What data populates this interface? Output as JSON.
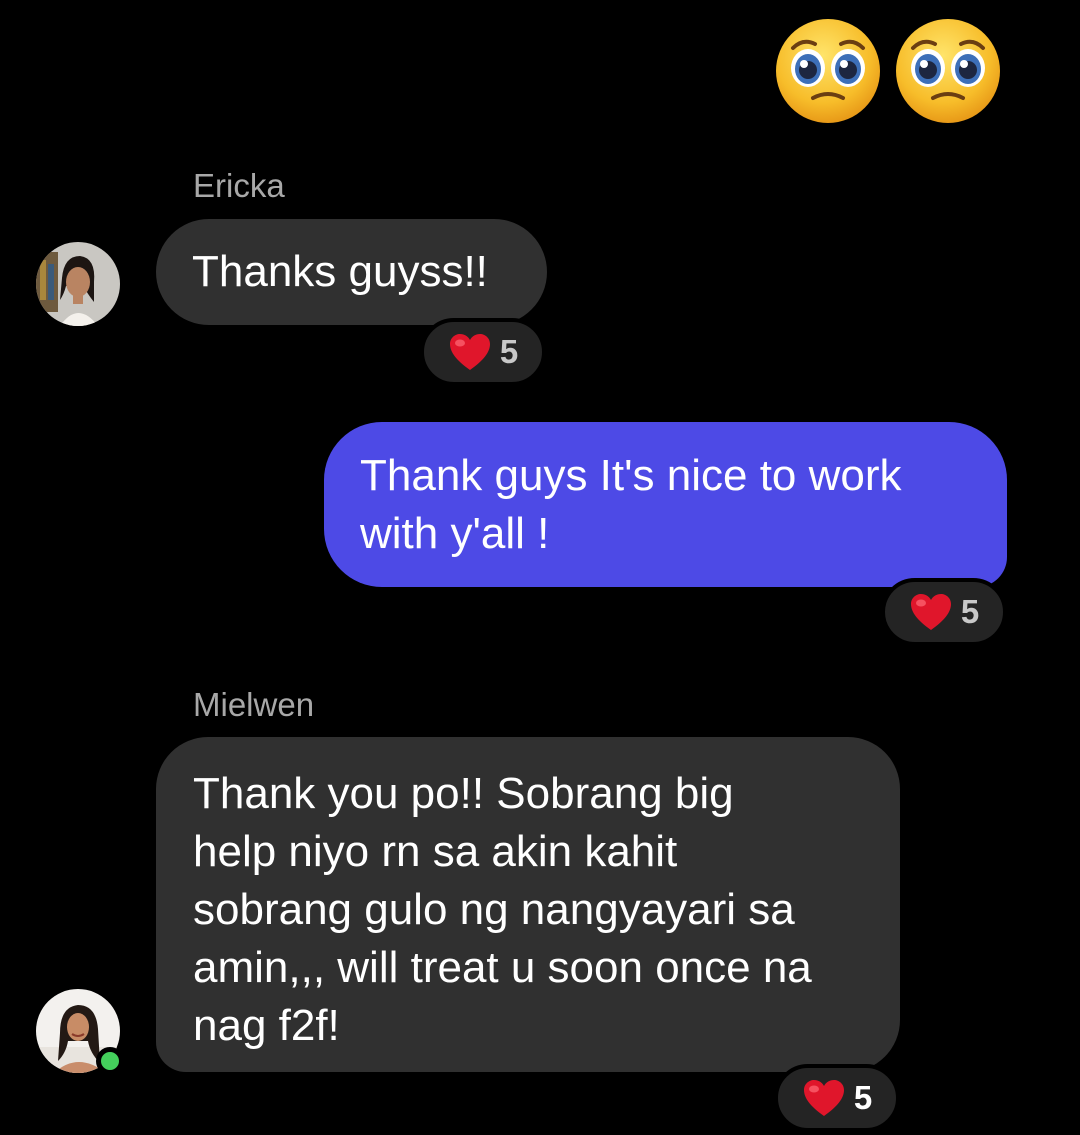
{
  "top_reactions": [
    {
      "icon": "pleading-face-emoji"
    },
    {
      "icon": "pleading-face-emoji"
    }
  ],
  "messages": [
    {
      "sender": "Ericka",
      "text": "Thanks guyss!!",
      "direction": "incoming",
      "avatar": "ericka-avatar",
      "reaction": {
        "icon": "red-heart-icon",
        "count": "5"
      }
    },
    {
      "sender": "",
      "text_lines": [
        "Thank guys It's nice to work",
        "with y'all !"
      ],
      "direction": "outgoing",
      "reaction": {
        "icon": "red-heart-icon",
        "count": "5"
      }
    },
    {
      "sender": "Mielwen",
      "text_lines": [
        "Thank you po!! Sobrang big",
        "help niyo rn sa akin kahit",
        "sobrang gulo ng nangyayari sa",
        "amin,,, will treat u soon once na",
        "nag f2f!"
      ],
      "direction": "incoming",
      "avatar": "mielwen-avatar",
      "online": true,
      "reaction": {
        "icon": "red-heart-icon",
        "count": "5"
      }
    }
  ],
  "colors": {
    "background": "#000000",
    "incoming_bubble": "#303030",
    "outgoing_bubble": "#4d4ae6",
    "sender_name": "#a8a8a8",
    "online": "#44d05c",
    "heart": "#e0162b"
  }
}
